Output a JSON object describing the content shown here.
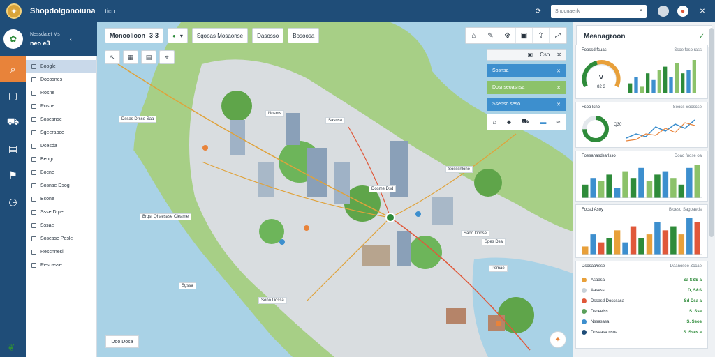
{
  "app": {
    "title": "Shopdolgonoiuna",
    "subtitle": "tico"
  },
  "topbar": {
    "search_placeholder": "Snoonaenk"
  },
  "sidebar": {
    "header_line1": "Nessdatet Ms",
    "header_line2": "neo e3",
    "items": [
      "Boogle",
      "Docosnes",
      "Rosne",
      "Rosne",
      "Sosesnse",
      "Sgeerapce",
      "Dcesda",
      "Beogd",
      "Bocne",
      "Sosnse Dsog",
      "Bcone",
      "Ssse Drpe",
      "Sssae",
      "Sosesse Pesle",
      "Rescnnesl",
      "Rescasse"
    ]
  },
  "map_toolbar": {
    "title": "Monoolioon",
    "title_badge": "3-3",
    "chip1": "Sqooas Mosaonse",
    "chip2": "Dasosso",
    "chip3": "Bosoosa"
  },
  "layers": {
    "head1": "Cso",
    "items": [
      "Sosnsa",
      "Dosnseoasnsa",
      "Ssenso seso"
    ]
  },
  "map_labels": [
    "Dssas Drsse Saa",
    "Sasnsa",
    "Brqsr Qhaesase Clearne",
    "Nosms",
    "Sosssnlone",
    "Dosme Dsd",
    "Saoo Doose",
    "Psmae",
    "Sono Dossa",
    "Spes Dsa",
    "Sgssa"
  ],
  "scale_label": "Doo Dosa",
  "right_panel": {
    "title": "Meanagroon",
    "cards": [
      {
        "head": "Foossd fcuas",
        "right": "Ssoe faso rass"
      },
      {
        "head": "Fsoo lsno",
        "right": "Sooss Sooscse"
      },
      {
        "head": "Foesanasdsarlsso",
        "right": "Doad fuose oa"
      },
      {
        "head": "Focsd Asoy",
        "right": "Bloesd Sagoaeds"
      },
      {
        "head": "Dsosaa/rsse",
        "right": "Daanosoe Zccae"
      }
    ],
    "gauge_value": "V",
    "gauge_sub": "82 3",
    "donut_value": "Q30",
    "list": [
      {
        "label": "Asaasa",
        "value": "Sa S&S a"
      },
      {
        "label": "Aasess",
        "value": "D, S&S"
      },
      {
        "label": "Dssasd Dosssasa",
        "value": "Sd Dsa a"
      },
      {
        "label": "Dsoeelss",
        "value": "S. Ssa"
      },
      {
        "label": "Nssasasa",
        "value": "S. Ssos"
      },
      {
        "label": "Dosaasa nsoa",
        "value": "S. Sses a"
      }
    ],
    "list_colors": [
      "#e8a03a",
      "#c8d1d8",
      "#e0583a",
      "#5aa05a",
      "#3d8fce",
      "#1f4d78"
    ]
  },
  "chart_data": [
    {
      "type": "bar",
      "values": [
        3,
        5,
        2,
        6,
        4,
        7,
        8,
        5,
        9,
        6,
        7,
        10
      ],
      "series_colors": [
        "#2e8b3a",
        "#3d8fce",
        "#8cc26a"
      ]
    },
    {
      "type": "bar",
      "values": [
        2,
        4,
        3,
        5,
        6,
        4,
        7,
        5,
        6,
        8,
        3,
        5
      ],
      "series_colors": [
        "#3d8fce",
        "#2e8b3a",
        "#e8833a"
      ]
    },
    {
      "type": "bar",
      "values": [
        4,
        6,
        5,
        7,
        3,
        8,
        6,
        9,
        5,
        7,
        8,
        6,
        4,
        9,
        10
      ],
      "series_colors": [
        "#2e8b3a",
        "#3d8fce",
        "#8cc26a"
      ]
    },
    {
      "type": "bar",
      "values": [
        2,
        5,
        3,
        4,
        6,
        3,
        7,
        4,
        5,
        8,
        6,
        7,
        5,
        9,
        8
      ],
      "series_colors": [
        "#e8a03a",
        "#3d8fce",
        "#e0583a",
        "#2e8b3a"
      ]
    }
  ]
}
